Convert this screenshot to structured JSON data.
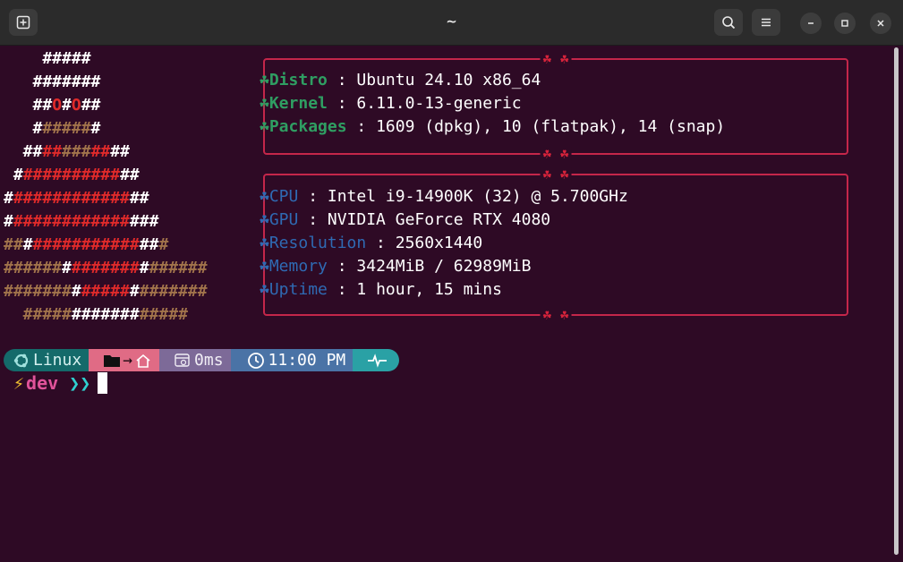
{
  "window": {
    "title": "~"
  },
  "logo": {
    "lines": [
      [
        [
          "w",
          "    #####"
        ]
      ],
      [
        [
          "w",
          "   #######"
        ]
      ],
      [
        [
          "w",
          "   ##"
        ],
        [
          "r",
          "O"
        ],
        [
          "w",
          "#"
        ],
        [
          "r",
          "O"
        ],
        [
          "w",
          "##"
        ]
      ],
      [
        [
          "w",
          "   #"
        ],
        [
          "b",
          "#####"
        ],
        [
          "w",
          "#"
        ]
      ],
      [
        [
          "w",
          "  ##"
        ],
        [
          "r",
          "##"
        ],
        [
          "b",
          "###"
        ],
        [
          "r",
          "##"
        ],
        [
          "w",
          "##"
        ]
      ],
      [
        [
          "w",
          " #"
        ],
        [
          "r",
          "##########"
        ],
        [
          "w",
          "##"
        ]
      ],
      [
        [
          "w",
          "#"
        ],
        [
          "r",
          "############"
        ],
        [
          "w",
          "##"
        ]
      ],
      [
        [
          "w",
          "#"
        ],
        [
          "r",
          "############"
        ],
        [
          "w",
          "###"
        ]
      ],
      [
        [
          "b",
          "##"
        ],
        [
          "w",
          "#"
        ],
        [
          "r",
          "###########"
        ],
        [
          "w",
          "##"
        ],
        [
          "b",
          "#"
        ]
      ],
      [
        [
          "b",
          "######"
        ],
        [
          "w",
          "#"
        ],
        [
          "r",
          "#######"
        ],
        [
          "w",
          "#"
        ],
        [
          "b",
          "######"
        ]
      ],
      [
        [
          "b",
          "#######"
        ],
        [
          "w",
          "#"
        ],
        [
          "r",
          "#####"
        ],
        [
          "w",
          "#"
        ],
        [
          "b",
          "#######"
        ]
      ],
      [
        [
          "b",
          "  #####"
        ],
        [
          "w",
          "#######"
        ],
        [
          "b",
          "#####"
        ]
      ]
    ]
  },
  "box_clover": "☘ ☘",
  "system": [
    {
      "label": "Distro",
      "sep": " : ",
      "value": "Ubuntu 24.10 x86_64"
    },
    {
      "label": "Kernel",
      "sep": " : ",
      "value": "6.11.0-13-generic"
    },
    {
      "label": "Packages",
      "sep": " : ",
      "value": "1609 (dpkg), 10 (flatpak), 14 (snap)"
    }
  ],
  "hardware": [
    {
      "label": "CPU",
      "sep": " : ",
      "value": "Intel i9-14900K (32) @ 5.700GHz"
    },
    {
      "label": "GPU",
      "sep": " : ",
      "value": "NVIDIA GeForce RTX 4080"
    },
    {
      "label": "Resolution",
      "sep": " : ",
      "value": "2560x1440"
    },
    {
      "label": "Memory",
      "sep": " : ",
      "value": "3424MiB / 62989MiB"
    },
    {
      "label": "Uptime",
      "sep": " : ",
      "value": "1 hour, 15 mins"
    }
  ],
  "bullet": "☘",
  "prompt": {
    "os": "Linux",
    "path_arrow": "→",
    "duration": "0ms",
    "time": "11:00 PM",
    "user": "dev",
    "chevrons": "❯❯"
  },
  "colors": {
    "background": "#2e0a25",
    "accent_red": "#c4264a",
    "green": "#2f9e62",
    "blue": "#2f6ab3",
    "seg_os": "#146a6a",
    "seg_path": "#e06b85",
    "seg_duration": "#7d6a98",
    "seg_time": "#4a73a6",
    "seg_health": "#2aa1a5"
  }
}
